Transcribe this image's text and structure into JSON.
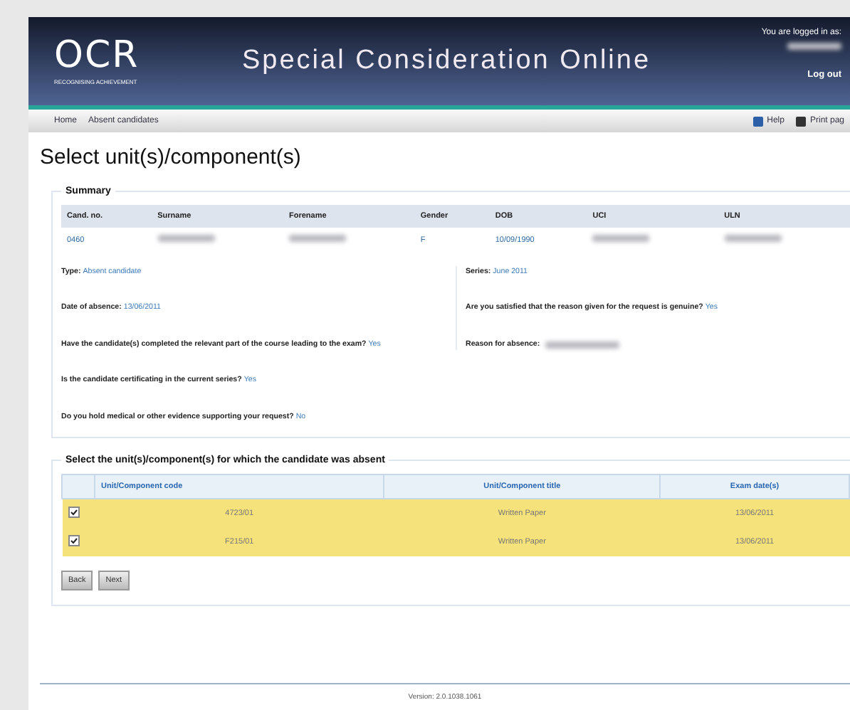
{
  "header": {
    "logo": "OCR",
    "logo_tagline": "RECOGNISING ACHIEVEMENT",
    "title": "Special Consideration Online",
    "login_label": "You are logged in as:",
    "logout": "Log out"
  },
  "breadcrumb": [
    "Home",
    "Absent candidates"
  ],
  "tools": [
    "Help",
    "Print pag"
  ],
  "page_title": "Select unit(s)/component(s)",
  "summary": {
    "legend": "Summary",
    "columns": [
      "Cand. no.",
      "Surname",
      "Forename",
      "Gender",
      "DOB",
      "UCI",
      "ULN"
    ],
    "row": [
      {
        "text": "0460",
        "redacted": false
      },
      {
        "redacted": true
      },
      {
        "redacted": true
      },
      {
        "text": "F",
        "redacted": false
      },
      {
        "text": "10/09/1990",
        "redacted": false
      },
      {
        "redacted": true
      },
      {
        "redacted": true
      }
    ],
    "left": [
      {
        "label": "Type:",
        "value": "Absent candidate"
      },
      {
        "label": "Date of absence:",
        "value": "13/06/2011"
      },
      {
        "label": "Have the candidate(s) completed the relevant part of the course leading to the exam?",
        "value": "Yes"
      },
      {
        "label": "Is the candidate certificating in the current series?",
        "value": "Yes"
      },
      {
        "label": "Do you hold medical or other evidence supporting your request?",
        "value": "No"
      }
    ],
    "right": [
      {
        "label": "Series:",
        "value": "June 2011",
        "redacted": false
      },
      {
        "label": "Are you satisfied that the reason given for the request is genuine?",
        "value": "Yes",
        "redacted": false
      },
      {
        "label": "Reason for absence:",
        "redacted": true
      }
    ]
  },
  "units": {
    "legend": "Select the unit(s)/component(s) for which the candidate was absent",
    "columns": [
      "Unit/Component code",
      "Unit/Component title",
      "Exam date(s)"
    ],
    "rows": [
      {
        "checked": true,
        "code": "4723/01",
        "title": "Written Paper",
        "date": "13/06/2011"
      },
      {
        "checked": true,
        "code": "F215/01",
        "title": "Written Paper",
        "date": "13/06/2011"
      }
    ]
  },
  "buttons": [
    "Back",
    "Next"
  ],
  "footer": "Version: 2.0.1038.1061"
}
